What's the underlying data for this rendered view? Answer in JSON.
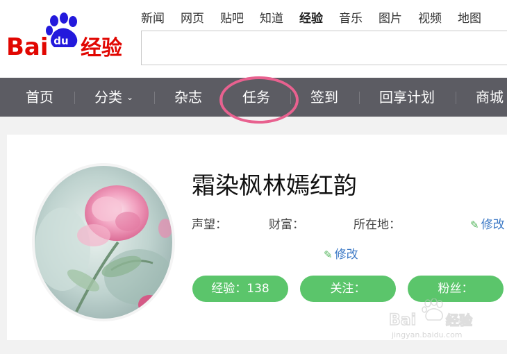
{
  "brand": {
    "logo_text": "Bai du 经验",
    "logo_color_red": "#e10601",
    "logo_color_blue": "#2319dc"
  },
  "top_nav": [
    "新闻",
    "网页",
    "贴吧",
    "知道",
    "经验",
    "音乐",
    "图片",
    "视频",
    "地图"
  ],
  "top_nav_active": "经验",
  "search": {
    "value": "",
    "placeholder": ""
  },
  "main_nav": {
    "home": "首页",
    "category": "分类",
    "magazine": "杂志",
    "tasks": "任务",
    "checkin": "签到",
    "share_plan": "回享计划",
    "mall": "商城"
  },
  "profile": {
    "username": "霜染枫林嫣红韵",
    "reputation_label": "声望：",
    "wealth_label": "财富：",
    "location_label": "所在地：",
    "edit_label": "修改",
    "experience_button": "经验：138",
    "follow_button": "关注：",
    "fans_button": "粉丝："
  },
  "watermark": {
    "text": "Bai du 经验",
    "url": "jingyan.baidu.com"
  },
  "colors": {
    "nav_bg": "#5c5c63",
    "button_green": "#5bc56b",
    "highlight_pink": "#e8618f",
    "link_blue": "#3b78c5"
  }
}
